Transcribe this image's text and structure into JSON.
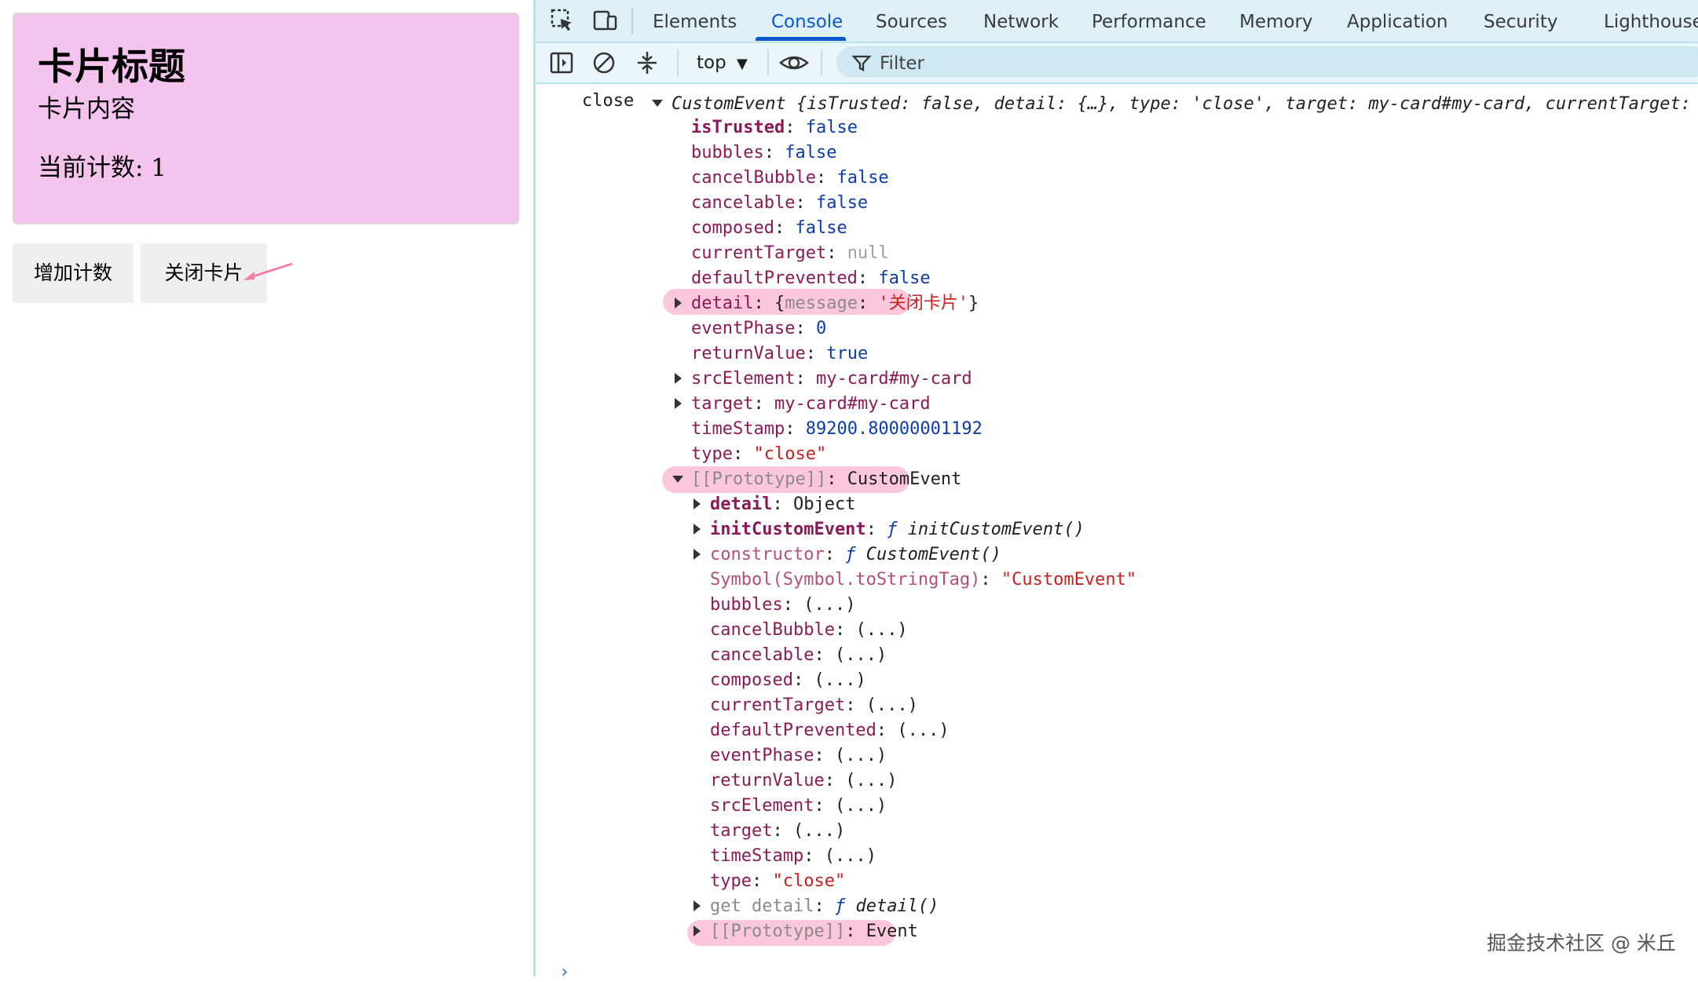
{
  "page": {
    "card_title": "卡片标题",
    "card_content": "卡片内容",
    "count_text": "当前计数: 1",
    "increment_button": "增加计数",
    "close_button": "关闭卡片"
  },
  "devtools": {
    "tabs": [
      "Elements",
      "Console",
      "Sources",
      "Network",
      "Performance",
      "Memory",
      "Application",
      "Security",
      "Lighthouse"
    ],
    "active_tab": "Console",
    "context": "top",
    "filter_placeholder": "Filter"
  },
  "console": {
    "log_label": "close",
    "summary": {
      "type": "CustomEvent",
      "preview": "{isTrusted: false, detail: {…}, type: 'close', target: my-card#my-card, currentTarget:"
    },
    "props": {
      "isTrusted": "false",
      "bubbles": "false",
      "cancelBubble": "false",
      "cancelable": "false",
      "composed": "false",
      "currentTarget": "null",
      "defaultPrevented": "false",
      "detail_message": "'关闭卡片'",
      "eventPhase": "0",
      "returnValue": "true",
      "srcElement": "my-card#my-card",
      "target": "my-card#my-card",
      "timeStamp": "89200.80000001192",
      "type": "\"close\""
    },
    "prototype": {
      "label": "CustomEvent",
      "detail": "Object",
      "initCustomEvent": "initCustomEvent()",
      "constructor": "CustomEvent()",
      "toStringTag": "\"CustomEvent\"",
      "getters": [
        "bubbles",
        "cancelBubble",
        "cancelable",
        "composed",
        "currentTarget",
        "defaultPrevented",
        "eventPhase",
        "returnValue",
        "srcElement",
        "target",
        "timeStamp"
      ],
      "accessor_value": "(...)",
      "type": "\"close\"",
      "get_detail": "detail()",
      "inner_prototype": "Event"
    }
  },
  "watermark": "掘金技术社区 @ 米丘"
}
